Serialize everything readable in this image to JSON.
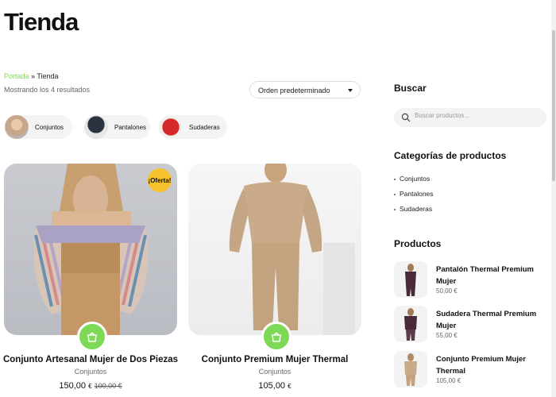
{
  "page": {
    "title": "Tienda"
  },
  "breadcrumb": {
    "home": "Portada",
    "separator": " » ",
    "current": "Tienda"
  },
  "results": {
    "count_text": "Mostrando los 4 resultados"
  },
  "orderby": {
    "selected": "Orden predeterminado"
  },
  "categories": [
    {
      "label": "Conjuntos"
    },
    {
      "label": "Pantalones"
    },
    {
      "label": "Sudaderas"
    }
  ],
  "products": [
    {
      "title": "Conjunto Artesanal Mujer de Dos Piezas",
      "category": "Conjuntos",
      "price": "150,00",
      "currency": "€",
      "old_price": "100,00 €",
      "badge": "¡Oferta!"
    },
    {
      "title": "Conjunto Premium Mujer Thermal",
      "category": "Conjuntos",
      "price": "105,00",
      "currency": "€"
    }
  ],
  "sidebar": {
    "search": {
      "title": "Buscar",
      "placeholder": "Buscar productos..."
    },
    "categories": {
      "title": "Categorías de productos",
      "items": [
        "Conjuntos",
        "Pantalones",
        "Sudaderas"
      ]
    },
    "products": {
      "title": "Productos",
      "items": [
        {
          "title": "Pantalón Thermal Premium Mujer",
          "price": "50,00 €"
        },
        {
          "title": "Sudadera Thermal Premium Mujer",
          "price": "55,00 €"
        },
        {
          "title": "Conjunto Premium Mujer Thermal",
          "price": "105,00 €"
        }
      ]
    }
  },
  "colors": {
    "accent": "#7ed957",
    "badge": "#f7c22b"
  }
}
